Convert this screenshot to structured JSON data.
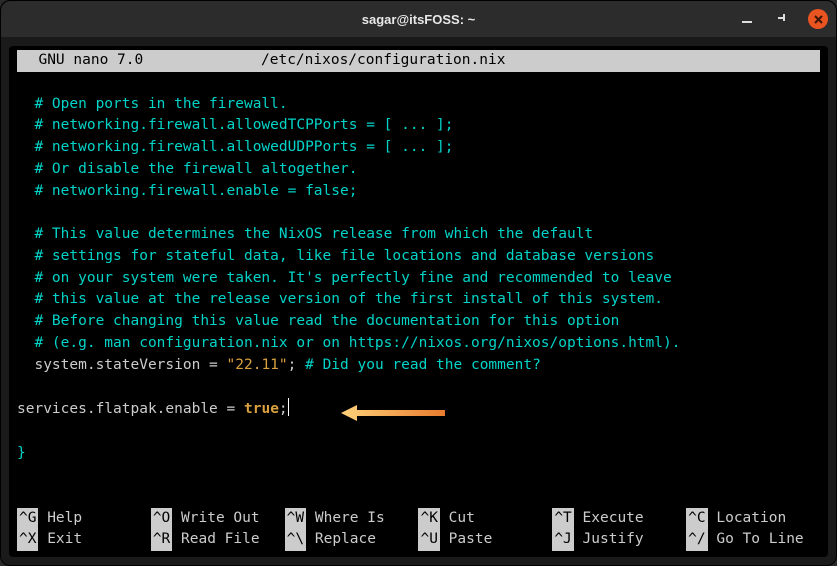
{
  "window": {
    "title": "sagar@itsFOSS: ~"
  },
  "nano": {
    "app": "  GNU nano 7.0",
    "file": "/etc/nixos/configuration.nix"
  },
  "code": {
    "l1": "  # Open ports in the firewall.",
    "l2": "  # networking.firewall.allowedTCPPorts = [ ... ];",
    "l3": "  # networking.firewall.allowedUDPPorts = [ ... ];",
    "l4": "  # Or disable the firewall altogether.",
    "l5": "  # networking.firewall.enable = false;",
    "l6": "",
    "l7": "  # This value determines the NixOS release from which the default",
    "l8": "  # settings for stateful data, like file locations and database versions",
    "l9": "  # on your system were taken. It's perfectly fine and recommended to leave",
    "l10": "  # this value at the release version of the first install of this system.",
    "l11": "  # Before changing this value read the documentation for this option",
    "l12": "  # (e.g. man configuration.nix or on https://nixos.org/nixos/options.html).",
    "sv_key": "  system.stateVersion",
    "sv_eq": " = ",
    "sv_val": "\"22.11\"",
    "sv_end": "; ",
    "sv_cmt": "# Did you read the comment?",
    "l14": "",
    "fp_key": "services.flatpak.enable",
    "fp_eq": " = ",
    "fp_val": "true",
    "fp_end": ";",
    "l16": "",
    "brace": "}"
  },
  "shortcuts": {
    "r1c1k": "^G",
    "r1c1l": " Help",
    "r1c2k": "^O",
    "r1c2l": " Write Out",
    "r1c3k": "^W",
    "r1c3l": " Where Is",
    "r1c4k": "^K",
    "r1c4l": " Cut",
    "r1c5k": "^T",
    "r1c5l": " Execute",
    "r1c6k": "^C",
    "r1c6l": " Location",
    "r2c1k": "^X",
    "r2c1l": " Exit",
    "r2c2k": "^R",
    "r2c2l": " Read File",
    "r2c3k": "^\\",
    "r2c3l": " Replace",
    "r2c4k": "^U",
    "r2c4l": " Paste",
    "r2c5k": "^J",
    "r2c5l": " Justify",
    "r2c6k": "^/",
    "r2c6l": " Go To Line"
  }
}
